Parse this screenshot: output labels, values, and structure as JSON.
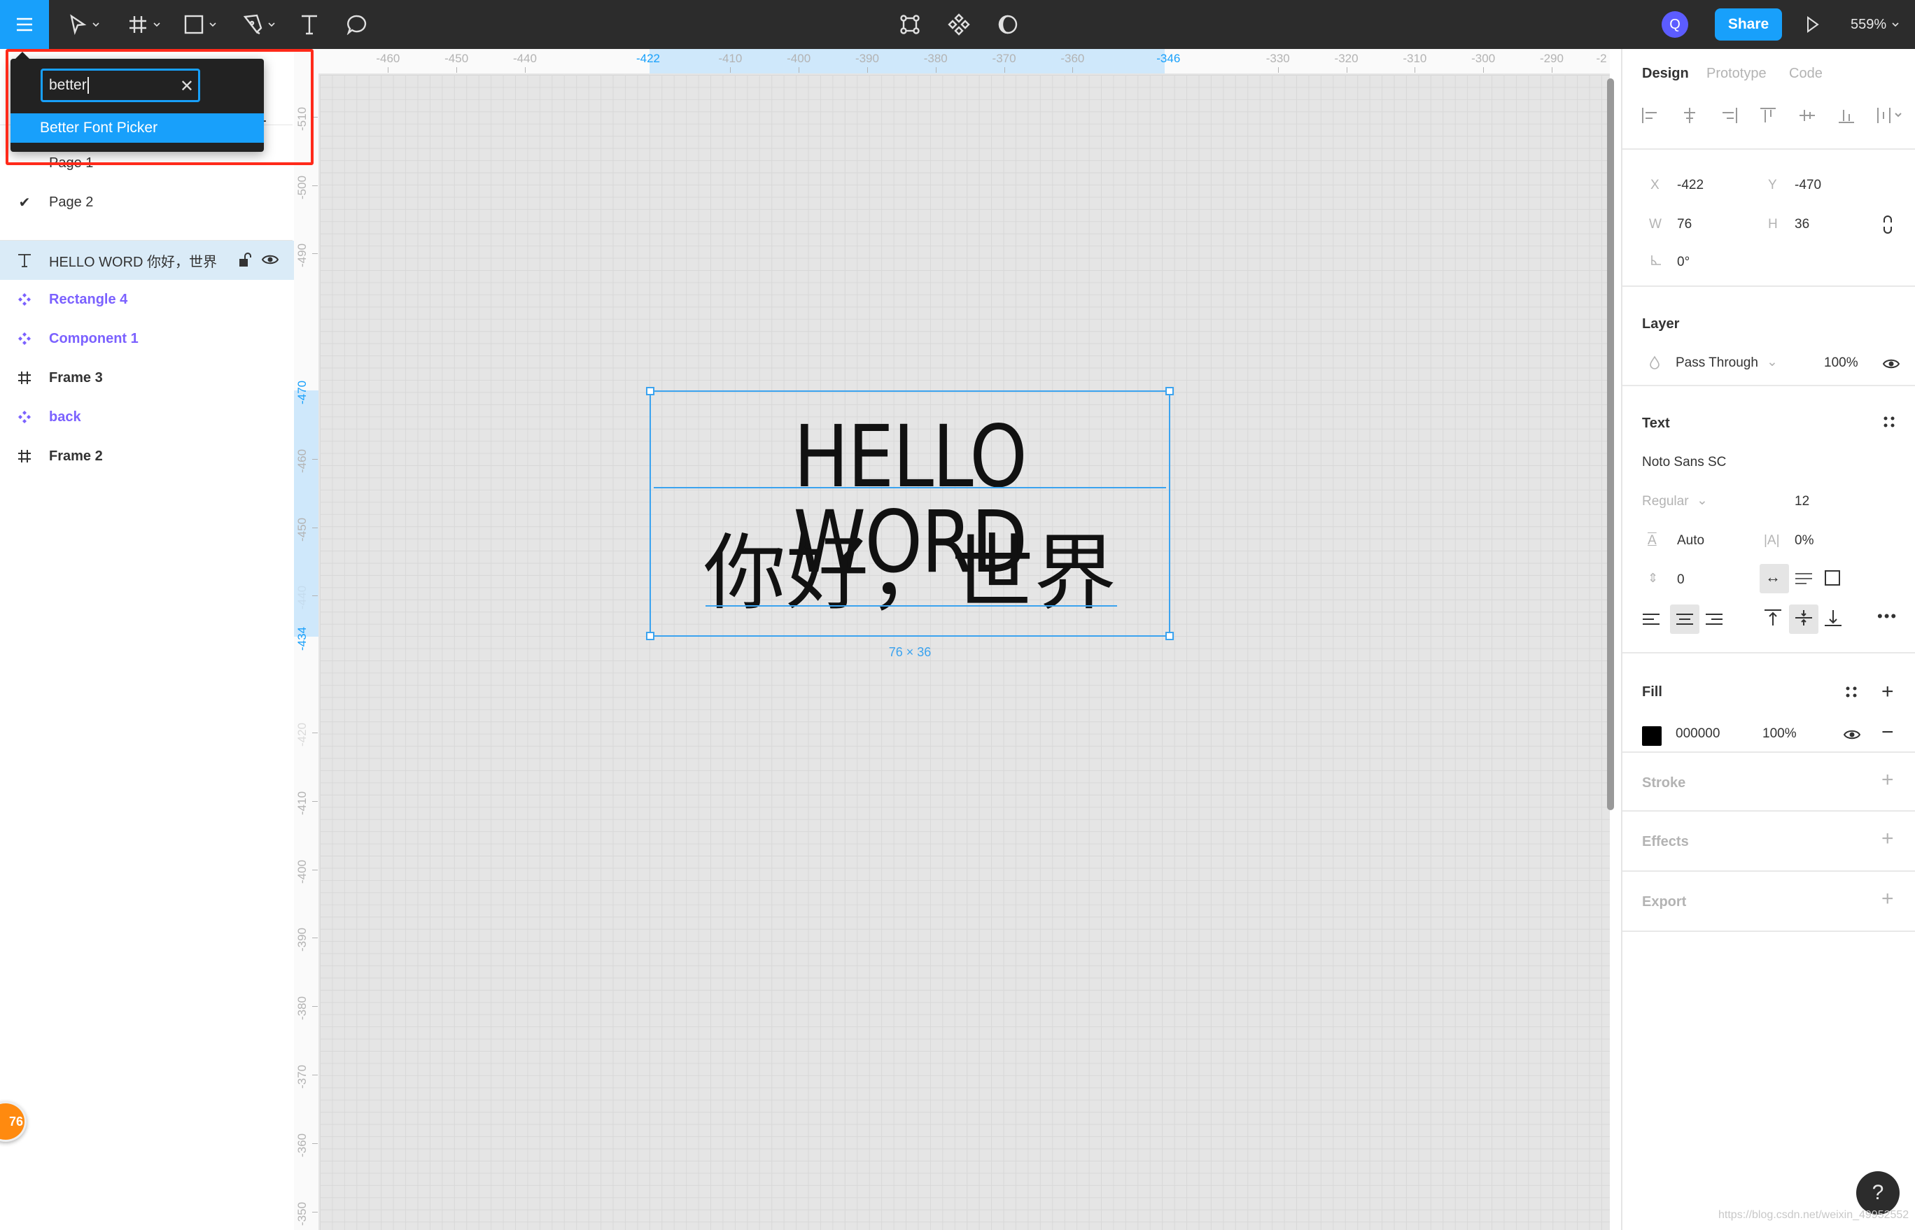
{
  "toolbar": {
    "menu_icon": "hamburger-icon",
    "tools": [
      {
        "name": "move-tool",
        "icon": "arrow-cursor-icon"
      },
      {
        "name": "frame-tool",
        "icon": "hash-frame-icon"
      },
      {
        "name": "shape-tool",
        "icon": "rectangle-icon"
      },
      {
        "name": "pen-tool",
        "icon": "pen-icon"
      },
      {
        "name": "text-tool",
        "icon": "text-t-icon"
      },
      {
        "name": "comment-tool",
        "icon": "speech-bubble-icon"
      }
    ],
    "center_tools": [
      {
        "name": "edit-object",
        "icon": "vector-nodes-icon"
      },
      {
        "name": "components",
        "icon": "component-diamonds-icon"
      },
      {
        "name": "mask",
        "icon": "half-moon-icon"
      }
    ],
    "avatar_initial": "Q",
    "share_label": "Share",
    "present_icon": "play-icon",
    "zoom_level": "559%"
  },
  "plugin_search": {
    "query": "better",
    "clear_icon": "close-icon",
    "results": [
      {
        "label": "Better Font Picker",
        "match": "Better"
      }
    ]
  },
  "pages": [
    {
      "label": "Page 1",
      "current": false
    },
    {
      "label": "Page 2",
      "current": true
    }
  ],
  "layers": [
    {
      "label": "HELLO WORD 你好，世界",
      "type": "text",
      "icon": "text-t-icon",
      "selected": true,
      "lock_icon": "unlock-icon",
      "visibility_icon": "eye-icon"
    },
    {
      "label": "Rectangle 4",
      "type": "component",
      "icon": "component-icon"
    },
    {
      "label": "Component 1",
      "type": "component",
      "icon": "component-icon"
    },
    {
      "label": "Frame 3",
      "type": "frame",
      "icon": "hash-frame-icon"
    },
    {
      "label": "back",
      "type": "component",
      "icon": "component-icon"
    },
    {
      "label": "Frame 2",
      "type": "frame",
      "icon": "hash-frame-icon"
    }
  ],
  "ruler_top": {
    "labels": [
      "-460",
      "-450",
      "-440",
      "-422",
      "-410",
      "-400",
      "-390",
      "-380",
      "-370",
      "-360",
      "-346",
      "-330",
      "-320",
      "-310",
      "-300",
      "-290",
      "-2"
    ],
    "highlight": [
      "-422",
      "-346"
    ]
  },
  "ruler_left": {
    "labels": [
      "-510",
      "-500",
      "-490",
      "-470",
      "-460",
      "-450",
      "-440",
      "-434",
      "-420",
      "-410",
      "-400",
      "-390",
      "-380",
      "-370",
      "-360",
      "-350"
    ],
    "highlight": [
      "-470",
      "-434"
    ]
  },
  "canvas": {
    "text_line1": "HELLO WORD",
    "text_line2": "你好，世界",
    "size_label": "76 × 36",
    "selection_color": "#3ba3ef"
  },
  "design_panel": {
    "tabs": [
      "Design",
      "Prototype",
      "Code"
    ],
    "active_tab": "Design",
    "align_icons": [
      "align-left-icon",
      "align-h-center-icon",
      "align-right-icon",
      "align-top-icon",
      "align-v-center-icon",
      "align-bottom-icon",
      "distribute-icon"
    ],
    "x_label": "X",
    "x": "-422",
    "y_label": "Y",
    "y": "-470",
    "w_label": "W",
    "w": "76",
    "h_label": "H",
    "h": "36",
    "rotation": "0°",
    "layer": {
      "title": "Layer",
      "blend_mode": "Pass Through",
      "opacity": "100%"
    },
    "text": {
      "title": "Text",
      "font_family": "Noto Sans SC",
      "font_style": "Regular",
      "font_size": "12",
      "line_height": "Auto",
      "letter_spacing": "0%",
      "paragraph_spacing": "0"
    },
    "fill": {
      "title": "Fill",
      "color_hex": "000000",
      "swatch": "#000000",
      "opacity": "100%"
    },
    "stroke_title": "Stroke",
    "effects_title": "Effects",
    "export_title": "Export"
  },
  "badge_count": "76",
  "help_label": "?",
  "watermark": "https://blog.csdn.net/weixin_49952552"
}
